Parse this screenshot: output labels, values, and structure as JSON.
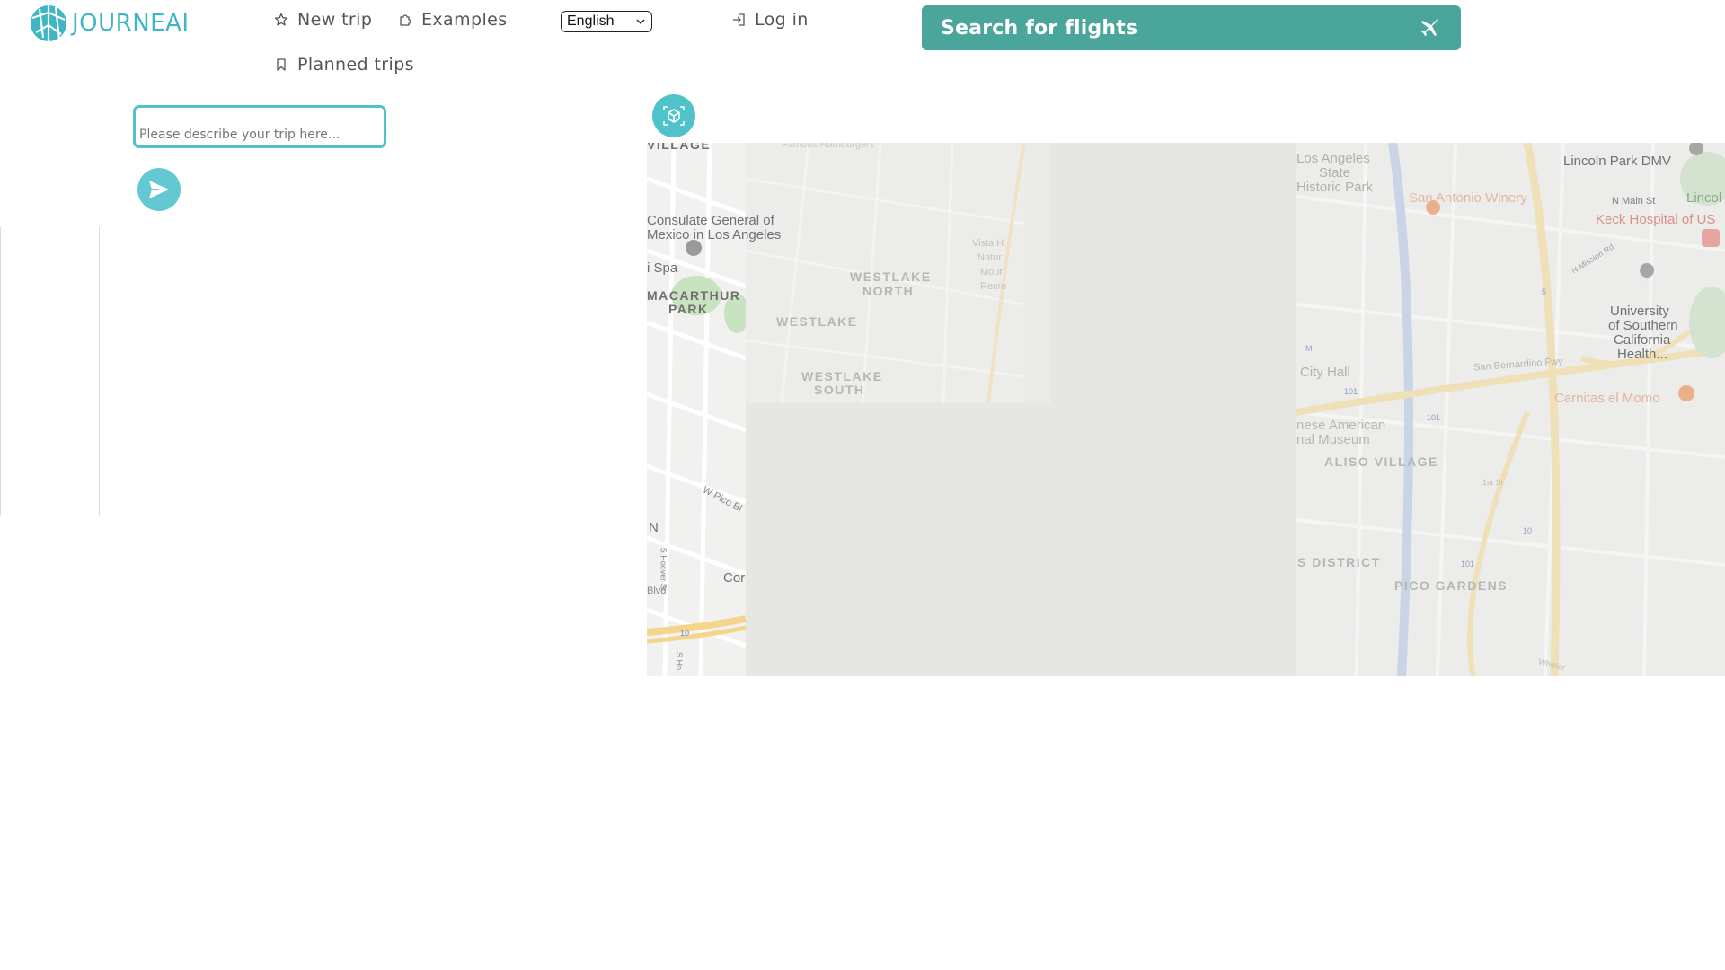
{
  "header": {
    "logo_text": "JOURNEAI",
    "nav": {
      "new_trip": "New trip",
      "examples": "Examples",
      "planned_trips": "Planned trips",
      "log_in": "Log in"
    },
    "language": {
      "selected": "English"
    },
    "flights_button": "Search for flights"
  },
  "trip_panel": {
    "input_placeholder": "Please describe your trip here..."
  },
  "map": {
    "labels": {
      "village": "VILLAGE",
      "consulate_1": "Consulate General of",
      "consulate_2": "Mexico in Los Angeles",
      "spa": "i Spa",
      "macarthur_1": "MACARTHUR",
      "macarthur_2": "PARK",
      "westlake_north_1": "WESTLAKE",
      "westlake_north_2": "NORTH",
      "westlake": "WESTLAKE",
      "westlake_south_1": "WESTLAKE",
      "westlake_south_2": "SOUTH",
      "vista_1": "Vista H",
      "vista_2": "Natur",
      "vista_3": "Mour",
      "vista_4": "Recre",
      "w_pico": "W Pico Bl",
      "n_label": "N",
      "s_hoover": "S Hoover St",
      "blvd": "Blvd",
      "cor": "Cor",
      "s_ho": "S Ho",
      "hamburgers": "Famous Hamburgers",
      "la_state_1": "Los Angeles",
      "la_state_2": "State",
      "la_state_3": "Historic Park",
      "winery": "San Antonio Winery",
      "dmv": "Lincoln Park DMV",
      "lincol": "Lincol",
      "n_main": "N Main St",
      "keck": "Keck Hospital of US",
      "mission": "N Mission Rd",
      "usc_1": "University",
      "usc_2": "of Southern",
      "usc_3": "California",
      "usc_4": "Health...",
      "city_hall": "City Hall",
      "sb_fwy": "San Bernardino Fwy",
      "carnitas": "Carnitas el Momo",
      "museum_1": "nese American",
      "museum_2": "nal Museum",
      "aliso": "ALISO VILLAGE",
      "first_st": "1st St",
      "arts": "S DISTRICT",
      "pico_gardens": "PICO GARDENS",
      "whittier": "Whittier",
      "hwy_101a": "101",
      "hwy_101b": "101",
      "hwy_101c": "101",
      "hwy_10a": "10",
      "hwy_10b": "10",
      "hwy_5": "5",
      "metro": "M"
    }
  }
}
